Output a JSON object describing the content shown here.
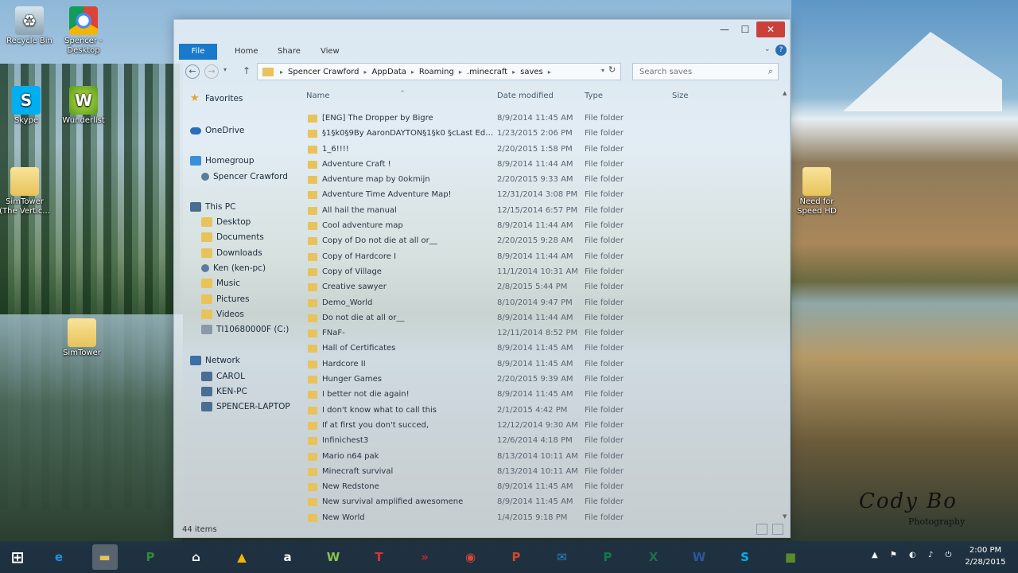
{
  "desktop": {
    "icons": [
      {
        "label": "Recycle Bin"
      },
      {
        "label": "Spencer - Desktop"
      },
      {
        "label": "Skype"
      },
      {
        "label": "Wunderlist"
      },
      {
        "label": "SimTower (The Vertic..."
      },
      {
        "label": "SimTower"
      },
      {
        "label": "Need for Speed HD"
      }
    ],
    "signature": {
      "main": "Cody Bo",
      "sub": "Photography"
    }
  },
  "window": {
    "controls": {
      "minimize": "—",
      "maximize": "☐",
      "close": "✕"
    },
    "ribbon_tabs": [
      "File",
      "Home",
      "Share",
      "View"
    ],
    "help": "?",
    "breadcrumbs": [
      "Spencer Crawford",
      "AppData",
      "Roaming",
      ".minecraft",
      "saves"
    ],
    "search": {
      "placeholder": "Search saves"
    },
    "nav": {
      "favorites": "Favorites",
      "onedrive": "OneDrive",
      "homegroup": "Homegroup",
      "homegroup_user": "Spencer Crawford",
      "thispc": "This PC",
      "thispc_items": [
        "Desktop",
        "Documents",
        "Downloads",
        "Ken (ken-pc)",
        "Music",
        "Pictures",
        "Videos",
        "TI10680000F (C:)"
      ],
      "network": "Network",
      "network_items": [
        "CAROL",
        "KEN-PC",
        "SPENCER-LAPTOP"
      ]
    },
    "columns": {
      "name": "Name",
      "date": "Date modified",
      "type": "Type",
      "size": "Size"
    },
    "files": [
      {
        "name": "[ENG] The Dropper by Bigre",
        "date": "8/9/2014 11:45 AM",
        "type": "File folder"
      },
      {
        "name": "§1§k0§9By AaronDAYTON§1§k0 §cLast Edi...",
        "date": "1/23/2015 2:06 PM",
        "type": "File folder"
      },
      {
        "name": "1_6!!!!",
        "date": "2/20/2015 1:58 PM",
        "type": "File folder"
      },
      {
        "name": "Adventure Craft !",
        "date": "8/9/2014 11:44 AM",
        "type": "File folder"
      },
      {
        "name": "Adventure map by 0okmijn",
        "date": "2/20/2015 9:33 AM",
        "type": "File folder"
      },
      {
        "name": "Adventure Time Adventure Map!",
        "date": "12/31/2014 3:08 PM",
        "type": "File folder"
      },
      {
        "name": "All hail the manual",
        "date": "12/15/2014 6:57 PM",
        "type": "File folder"
      },
      {
        "name": "Cool adventure map",
        "date": "8/9/2014 11:44 AM",
        "type": "File folder"
      },
      {
        "name": "Copy of Do not die at all or__",
        "date": "2/20/2015 9:28 AM",
        "type": "File folder"
      },
      {
        "name": "Copy of Hardcore I",
        "date": "8/9/2014 11:44 AM",
        "type": "File folder"
      },
      {
        "name": "Copy of Village",
        "date": "11/1/2014 10:31 AM",
        "type": "File folder"
      },
      {
        "name": "Creative sawyer",
        "date": "2/8/2015 5:44 PM",
        "type": "File folder"
      },
      {
        "name": "Demo_World",
        "date": "8/10/2014 9:47 PM",
        "type": "File folder"
      },
      {
        "name": "Do not die at all or__",
        "date": "8/9/2014 11:44 AM",
        "type": "File folder"
      },
      {
        "name": "FNaF-",
        "date": "12/11/2014 8:52 PM",
        "type": "File folder"
      },
      {
        "name": "Hall of Certificates",
        "date": "8/9/2014 11:45 AM",
        "type": "File folder"
      },
      {
        "name": "Hardcore II",
        "date": "8/9/2014 11:45 AM",
        "type": "File folder"
      },
      {
        "name": "Hunger Games",
        "date": "2/20/2015 9:39 AM",
        "type": "File folder"
      },
      {
        "name": "I better not die again!",
        "date": "8/9/2014 11:45 AM",
        "type": "File folder"
      },
      {
        "name": "I don't know what to call this",
        "date": "2/1/2015 4:42 PM",
        "type": "File folder"
      },
      {
        "name": "If at first you don't succed,",
        "date": "12/12/2014 9:30 AM",
        "type": "File folder"
      },
      {
        "name": "Infinichest3",
        "date": "12/6/2014 4:18 PM",
        "type": "File folder"
      },
      {
        "name": "Mario n64 pak",
        "date": "8/13/2014 10:11 AM",
        "type": "File folder"
      },
      {
        "name": "Minecraft survival",
        "date": "8/13/2014 10:11 AM",
        "type": "File folder"
      },
      {
        "name": "New Redstone",
        "date": "8/9/2014 11:45 AM",
        "type": "File folder"
      },
      {
        "name": "New survival amplified awesomene",
        "date": "8/9/2014 11:45 AM",
        "type": "File folder"
      },
      {
        "name": "New World",
        "date": "1/4/2015 9:18 PM",
        "type": "File folder"
      }
    ],
    "status": "44 items"
  },
  "taskbar": {
    "start": "⊞",
    "apps": [
      {
        "name": "Internet Explorer",
        "glyph": "e",
        "color": "#1e8fe0"
      },
      {
        "name": "File Explorer",
        "glyph": "▬",
        "color": "#e8c35a"
      },
      {
        "name": "Project",
        "glyph": "P",
        "color": "#2f8a3a"
      },
      {
        "name": "Home",
        "glyph": "⌂",
        "color": "#ffffff"
      },
      {
        "name": "Google Drive",
        "glyph": "▲",
        "color": "#f4b400"
      },
      {
        "name": "Amazon",
        "glyph": "a",
        "color": "#ffffff"
      },
      {
        "name": "Wunderlist",
        "glyph": "W",
        "color": "#8bc34a"
      },
      {
        "name": "Tumblr-T",
        "glyph": "T",
        "color": "#e03030"
      },
      {
        "name": "Media",
        "glyph": "»",
        "color": "#c62828"
      },
      {
        "name": "Chrome",
        "glyph": "◉",
        "color": "#db4437"
      },
      {
        "name": "PowerPoint",
        "glyph": "P",
        "color": "#d24726"
      },
      {
        "name": "Mail",
        "glyph": "✉",
        "color": "#1e88d0"
      },
      {
        "name": "Publisher",
        "glyph": "P",
        "color": "#107c41"
      },
      {
        "name": "Excel",
        "glyph": "X",
        "color": "#1e7145"
      },
      {
        "name": "Word",
        "glyph": "W",
        "color": "#2b579a"
      },
      {
        "name": "Skype",
        "glyph": "S",
        "color": "#00aff0"
      },
      {
        "name": "Minecraft",
        "glyph": "■",
        "color": "#5a8a2a"
      }
    ],
    "tray_icons": "▲ ⚑ ◐ ♪ ⏻",
    "time": "2:00 PM",
    "date": "2/28/2015"
  }
}
